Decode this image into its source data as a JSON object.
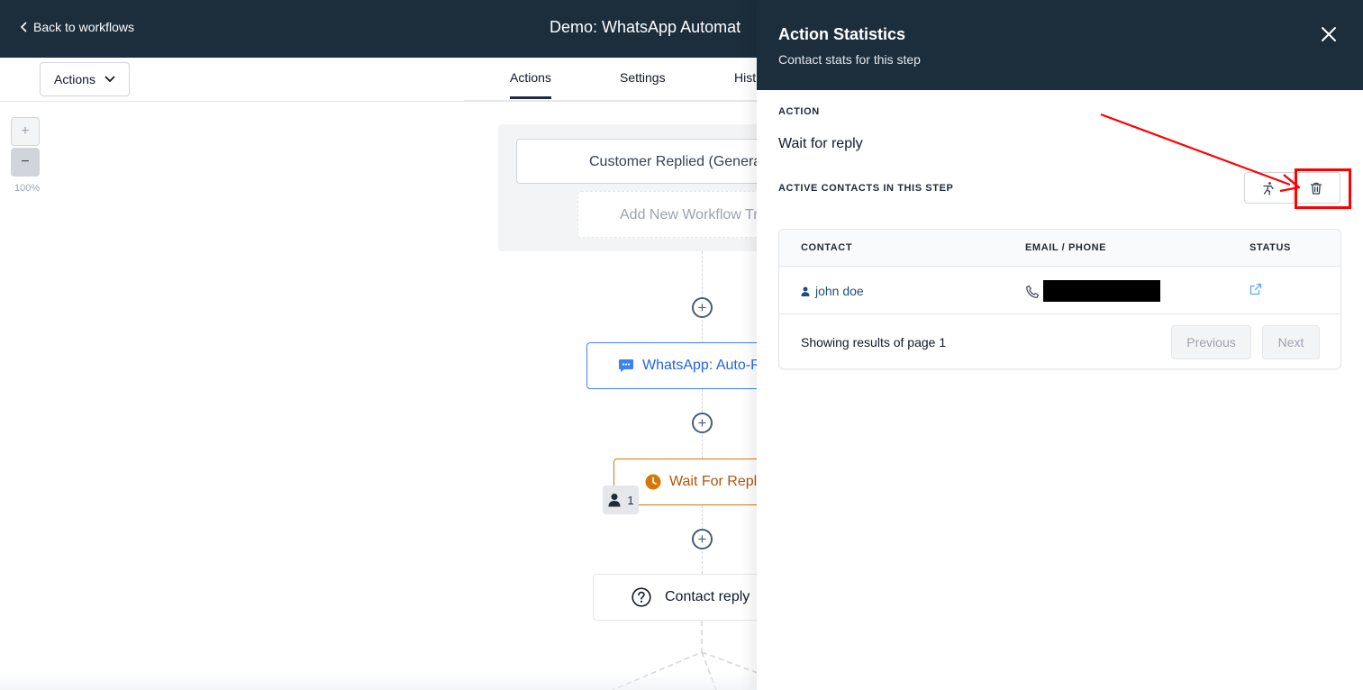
{
  "header": {
    "back_label": "Back to workflows",
    "workflow_title": "Demo: WhatsApp Automat"
  },
  "toolbar": {
    "actions_dropdown": "Actions",
    "tabs": [
      {
        "label": "Actions",
        "active": true
      },
      {
        "label": "Settings",
        "active": false
      },
      {
        "label": "Hist",
        "active": false
      }
    ]
  },
  "canvas": {
    "zoom_in": "+",
    "zoom_out": "−",
    "zoom_level": "100%",
    "trigger_label": "Customer Replied (Genera",
    "add_trigger_label": "Add New Workflow Tr",
    "nodes": {
      "whatsapp": "WhatsApp: Auto-R",
      "wait": "Wait For Reply",
      "wait_count": "1",
      "reply": "Contact reply"
    },
    "add_step_symbol": "+",
    "accent_colors": {
      "whatsapp": "#3b82f6",
      "wait": "#d97706"
    }
  },
  "panel": {
    "title": "Action Statistics",
    "subtitle": "Contact stats for this step",
    "action_label": "ACTION",
    "action_value": "Wait for reply",
    "active_contacts_label": "ACTIVE CONTACTS IN THIS STEP",
    "table": {
      "headers": [
        "CONTACT",
        "EMAIL / PHONE",
        "STATUS"
      ],
      "rows": [
        {
          "contact": "john doe",
          "phone_redacted": true
        }
      ],
      "footer_text": "Showing results of page 1",
      "prev_label": "Previous",
      "next_label": "Next"
    },
    "icons": [
      "close-icon",
      "skip-step-icon",
      "trash-icon",
      "user-icon",
      "phone-icon",
      "external-link-icon"
    ]
  },
  "annotation_color": "#ff0000"
}
